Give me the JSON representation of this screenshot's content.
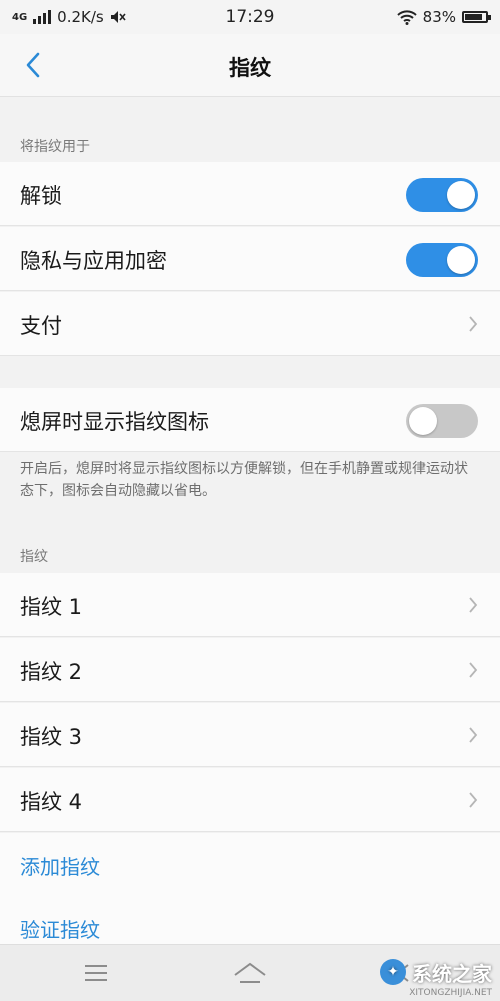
{
  "status_bar": {
    "network": "4G",
    "speed": "0.2K/s",
    "time": "17:29",
    "battery_percent_text": "83%",
    "battery_level": 0.83
  },
  "nav": {
    "title": "指纹"
  },
  "use_section": {
    "header": "将指纹用于",
    "unlock": {
      "label": "解锁",
      "enabled": true
    },
    "privacy": {
      "label": "隐私与应用加密",
      "enabled": true
    },
    "payment": {
      "label": "支付"
    }
  },
  "screen_off": {
    "label": "熄屏时显示指纹图标",
    "enabled": false,
    "description": "开启后，熄屏时将显示指纹图标以方便解锁，但在手机静置或规律运动状态下，图标会自动隐藏以省电。"
  },
  "fingerprints_section": {
    "header": "指纹",
    "items": [
      {
        "label": "指纹 1"
      },
      {
        "label": "指纹 2"
      },
      {
        "label": "指纹 3"
      },
      {
        "label": "指纹 4"
      }
    ],
    "add_label": "添加指纹",
    "verify_label": "验证指纹"
  },
  "watermark": {
    "text": "系统之家",
    "url": "XITONGZHIJIA.NET"
  },
  "colors": {
    "accent": "#2f8fe6",
    "link": "#2b8ad6",
    "toggle_off": "#c8c8c8"
  },
  "icons": [
    "back-chevron-icon",
    "chevron-right-icon",
    "menu-icon",
    "home-icon",
    "back-nav-icon",
    "wifi-icon",
    "signal-icon",
    "mute-icon",
    "battery-icon"
  ]
}
